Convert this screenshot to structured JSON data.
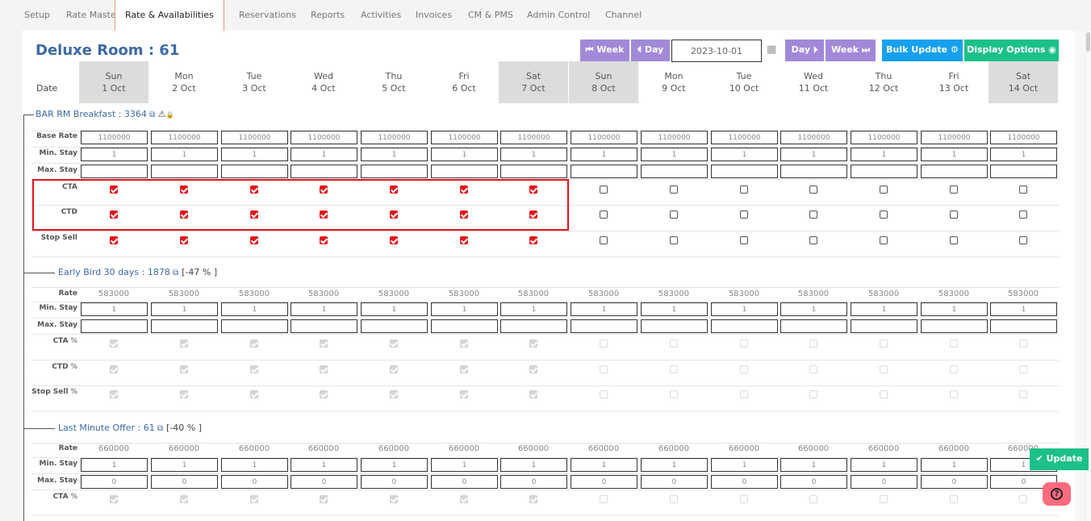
{
  "nav": [
    {
      "label": "Setup",
      "active": false
    },
    {
      "label": "Rate Master",
      "active": false
    },
    {
      "label": "Rate & Availabilities",
      "active": true
    },
    {
      "label": "Reservations",
      "active": false
    },
    {
      "label": "Reports",
      "active": false
    },
    {
      "label": "Activities",
      "active": false
    },
    {
      "label": "Invoices",
      "active": false
    },
    {
      "label": "CM & PMS",
      "active": false
    },
    {
      "label": "Admin Control",
      "active": false
    },
    {
      "label": "Channel",
      "active": false
    }
  ],
  "title": "Deluxe Room : 61",
  "toolbar": {
    "prev_week": "Week",
    "prev_day": "Day",
    "date_value": "2023-10-01",
    "next_day": "Day",
    "next_week": "Week",
    "bulk_update": "Bulk Update",
    "display_options": "Display Options"
  },
  "date_label": "Date",
  "days": [
    {
      "dow": "Sun",
      "date": "1 Oct",
      "weekend": true
    },
    {
      "dow": "Mon",
      "date": "2 Oct",
      "weekend": false
    },
    {
      "dow": "Tue",
      "date": "3 Oct",
      "weekend": false
    },
    {
      "dow": "Wed",
      "date": "4 Oct",
      "weekend": false
    },
    {
      "dow": "Thu",
      "date": "5 Oct",
      "weekend": false
    },
    {
      "dow": "Fri",
      "date": "6 Oct",
      "weekend": false
    },
    {
      "dow": "Sat",
      "date": "7 Oct",
      "weekend": true
    },
    {
      "dow": "Sun",
      "date": "8 Oct",
      "weekend": true
    },
    {
      "dow": "Mon",
      "date": "9 Oct",
      "weekend": false
    },
    {
      "dow": "Tue",
      "date": "10 Oct",
      "weekend": false
    },
    {
      "dow": "Wed",
      "date": "11 Oct",
      "weekend": false
    },
    {
      "dow": "Thu",
      "date": "12 Oct",
      "weekend": false
    },
    {
      "dow": "Fri",
      "date": "13 Oct",
      "weekend": false
    },
    {
      "dow": "Sat",
      "date": "14 Oct",
      "weekend": true
    }
  ],
  "plans": [
    {
      "name": "BAR RM Breakfast : 3364",
      "discount": "",
      "rows": [
        {
          "label": "Base Rate",
          "type": "input",
          "values": [
            "1100000",
            "1100000",
            "1100000",
            "1100000",
            "1100000",
            "1100000",
            "1100000",
            "1100000",
            "1100000",
            "1100000",
            "1100000",
            "1100000",
            "1100000",
            "1100000"
          ]
        },
        {
          "label": "Min. Stay",
          "type": "input",
          "values": [
            "1",
            "1",
            "1",
            "1",
            "1",
            "1",
            "1",
            "1",
            "1",
            "1",
            "1",
            "1",
            "1",
            "1"
          ]
        },
        {
          "label": "Max. Stay",
          "type": "input",
          "values": [
            "",
            "",
            "",
            "",
            "",
            "",
            "",
            "",
            "",
            "",
            "",
            "",
            "",
            ""
          ]
        },
        {
          "label": "CTA",
          "type": "check",
          "values": [
            true,
            true,
            true,
            true,
            true,
            true,
            true,
            false,
            false,
            false,
            false,
            false,
            false,
            false
          ]
        },
        {
          "label": "CTD",
          "type": "check",
          "values": [
            true,
            true,
            true,
            true,
            true,
            true,
            true,
            false,
            false,
            false,
            false,
            false,
            false,
            false
          ]
        },
        {
          "label": "Stop Sell",
          "type": "check",
          "values": [
            true,
            true,
            true,
            true,
            true,
            true,
            true,
            false,
            false,
            false,
            false,
            false,
            false,
            false
          ]
        }
      ]
    },
    {
      "name": "Early Bird 30 days : 1878",
      "discount": "[-47 % ]",
      "rows": [
        {
          "label": "Rate",
          "type": "text",
          "values": [
            "583000",
            "583000",
            "583000",
            "583000",
            "583000",
            "583000",
            "583000",
            "583000",
            "583000",
            "583000",
            "583000",
            "583000",
            "583000",
            "583000"
          ]
        },
        {
          "label": "Min. Stay",
          "type": "input",
          "values": [
            "1",
            "1",
            "1",
            "1",
            "1",
            "1",
            "1",
            "1",
            "1",
            "1",
            "1",
            "1",
            "1",
            "1"
          ]
        },
        {
          "label": "Max. Stay",
          "type": "input",
          "values": [
            "",
            "",
            "",
            "",
            "",
            "",
            "",
            "",
            "",
            "",
            "",
            "",
            "",
            ""
          ]
        },
        {
          "label": "CTA",
          "type": "dcheck",
          "values": [
            true,
            true,
            true,
            true,
            true,
            true,
            true,
            false,
            false,
            false,
            false,
            false,
            false,
            false
          ]
        },
        {
          "label": "CTD",
          "type": "dcheck",
          "values": [
            true,
            true,
            true,
            true,
            true,
            true,
            true,
            false,
            false,
            false,
            false,
            false,
            false,
            false
          ]
        },
        {
          "label": "Stop Sell",
          "type": "dcheck",
          "values": [
            true,
            true,
            true,
            true,
            true,
            true,
            true,
            false,
            false,
            false,
            false,
            false,
            false,
            false
          ]
        }
      ]
    },
    {
      "name": "Last Minute Offer : 61",
      "discount": "[-40 % ]",
      "rows": [
        {
          "label": "Rate",
          "type": "text",
          "values": [
            "660000",
            "660000",
            "660000",
            "660000",
            "660000",
            "660000",
            "660000",
            "660000",
            "660000",
            "660000",
            "660000",
            "660000",
            "660000",
            "660000"
          ]
        },
        {
          "label": "Min. Stay",
          "type": "input",
          "values": [
            "1",
            "1",
            "1",
            "1",
            "1",
            "1",
            "1",
            "1",
            "1",
            "1",
            "1",
            "1",
            "1",
            "1"
          ]
        },
        {
          "label": "Max. Stay",
          "type": "input",
          "values": [
            "0",
            "0",
            "0",
            "0",
            "0",
            "0",
            "0",
            "0",
            "0",
            "0",
            "0",
            "0",
            "0",
            "0"
          ]
        },
        {
          "label": "CTA",
          "type": "dcheck",
          "values": [
            true,
            true,
            true,
            true,
            true,
            true,
            true,
            false,
            false,
            false,
            false,
            false,
            false,
            false
          ]
        }
      ]
    }
  ],
  "update_button": "Update",
  "colors": {
    "accent_blue": "#3d6aa3",
    "purple": "#a189d8",
    "bulk_blue": "#17a0ef",
    "green": "#1cc089",
    "check_red": "#e3141b",
    "help_pink": "#ff6b7d"
  }
}
